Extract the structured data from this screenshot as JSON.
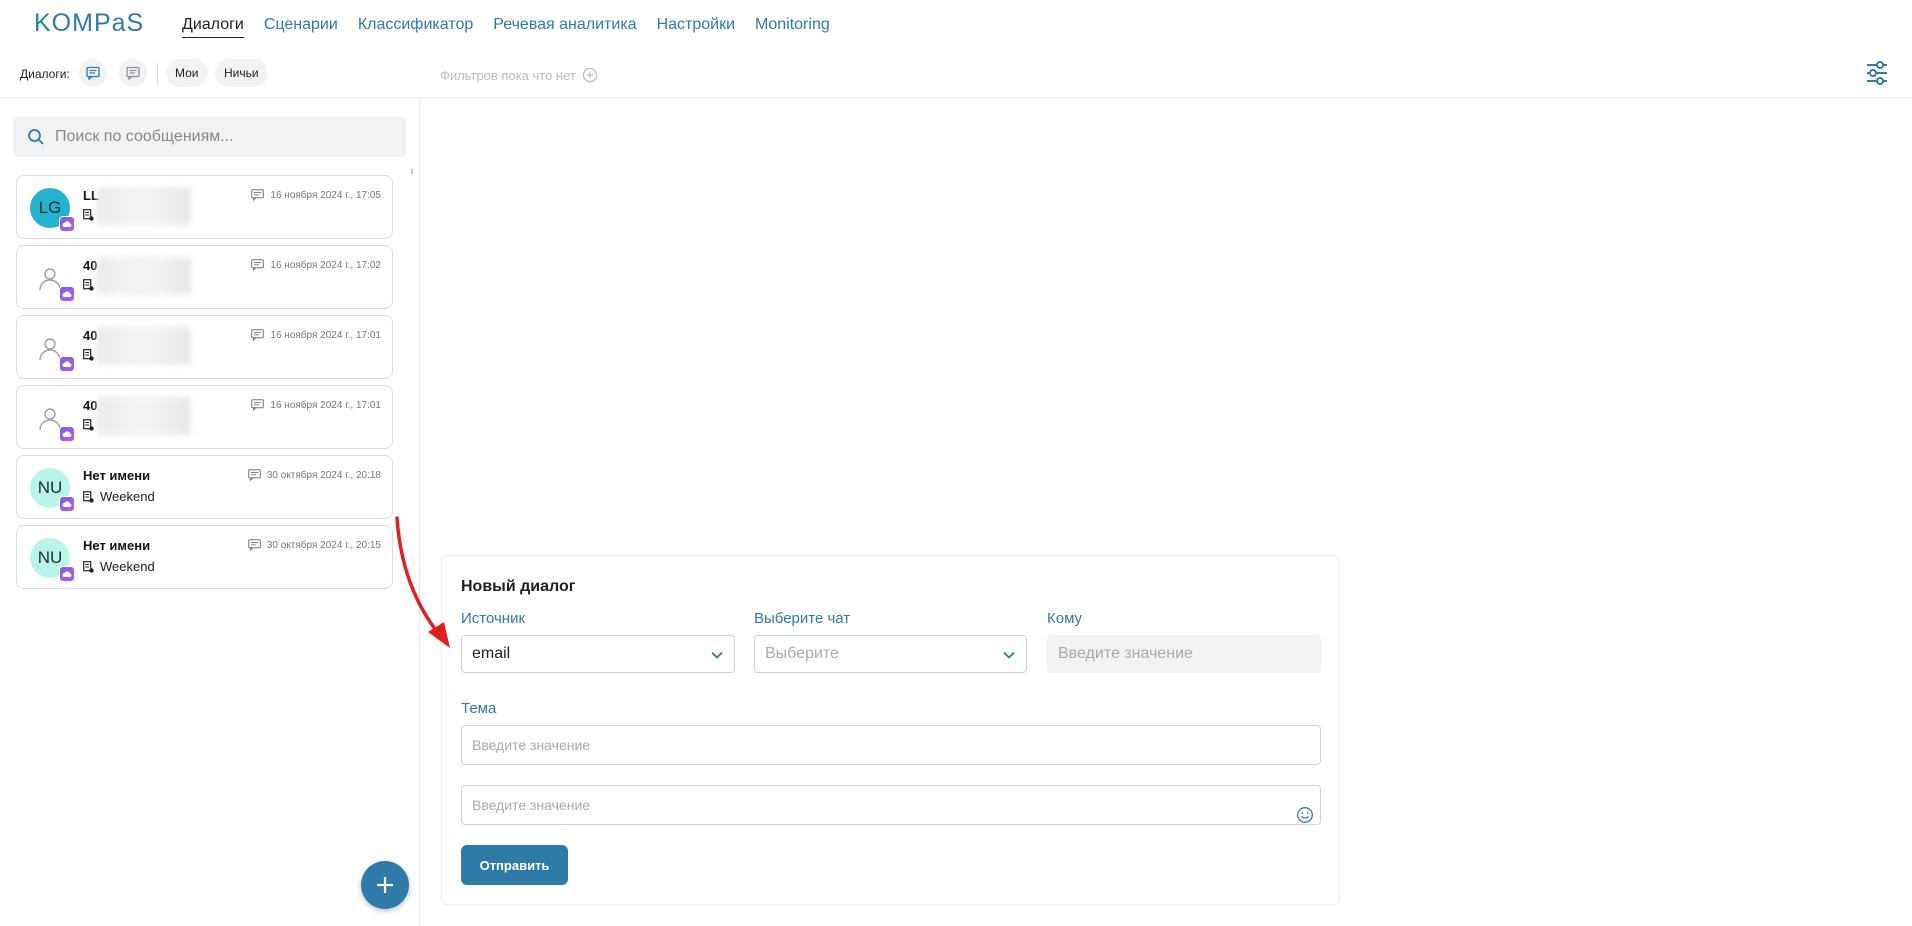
{
  "header": {
    "logo": "KOMPaS",
    "nav": [
      {
        "label": "Диалоги",
        "active": true
      },
      {
        "label": "Сценарии",
        "active": false
      },
      {
        "label": "Классификатор",
        "active": false
      },
      {
        "label": "Речевая аналитика",
        "active": false
      },
      {
        "label": "Настройки",
        "active": false
      },
      {
        "label": "Monitoring",
        "active": false
      }
    ]
  },
  "subbar": {
    "label": "Диалоги:",
    "pill_mine": "Мои",
    "pill_nobody": "Ничьи",
    "filters_text": "Фильтров пока что нет"
  },
  "sidebar": {
    "search_placeholder": "Поиск по сообщениям...",
    "dialogs": [
      {
        "initials": "LG",
        "name": "LL",
        "subtitle": "",
        "date": "16 ноября 2024 г., 17:05"
      },
      {
        "initials": "",
        "name": "40",
        "subtitle": "",
        "date": "16 ноября 2024 г., 17:02"
      },
      {
        "initials": "",
        "name": "40",
        "subtitle": "",
        "date": "16 ноября 2024 г., 17:01"
      },
      {
        "initials": "",
        "name": "40",
        "subtitle": "",
        "date": "16 ноября 2024 г., 17:01"
      },
      {
        "initials": "NU",
        "name": "Нет имени",
        "subtitle": "Weekend",
        "date": "30 октября 2024 г., 20:18"
      },
      {
        "initials": "NU",
        "name": "Нет имени",
        "subtitle": "Weekend",
        "date": "30 октября 2024 г., 20:15"
      }
    ]
  },
  "form": {
    "title": "Новый диалог",
    "source_label": "Источник",
    "source_value": "email",
    "chat_label": "Выберите чат",
    "chat_placeholder": "Выберите",
    "to_label": "Кому",
    "to_placeholder": "Введите значение",
    "subject_label": "Тема",
    "subject_placeholder": "Введите значение",
    "message_placeholder": "Введите значение",
    "send_label": "Отправить"
  },
  "colors": {
    "accent": "#2e7ba8",
    "avatar_teal": "#23b3cc",
    "avatar_mint": "#b8f5e8",
    "annotation_arrow": "#e01f1f"
  }
}
